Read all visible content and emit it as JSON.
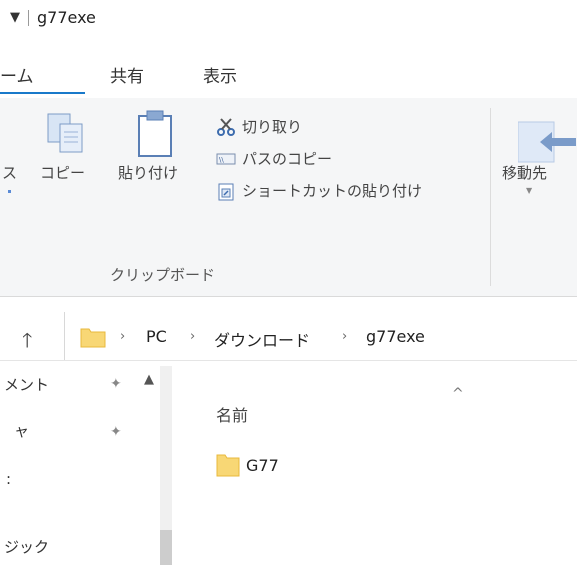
{
  "window": {
    "title": "g77exe"
  },
  "tabs": [
    {
      "label": "ーム"
    },
    {
      "label": "共有"
    },
    {
      "label": "表示"
    }
  ],
  "ribbon": {
    "clipboard": {
      "partial_label": "ス",
      "copy_label": "コピー",
      "paste_label": "貼り付け",
      "cut_label": "切り取り",
      "copy_path_label": "パスのコピー",
      "paste_shortcut_label": "ショートカットの貼り付け",
      "group_label": "クリップボード"
    },
    "organize": {
      "move_to_label": "移動先"
    }
  },
  "address_bar": {
    "breadcrumbs": [
      "PC",
      "ダウンロード",
      "g77exe"
    ]
  },
  "nav_pane": {
    "items": [
      {
        "label": "メント"
      },
      {
        "label": "ャ"
      },
      {
        "label": ":"
      },
      {
        "label": "ジック"
      }
    ]
  },
  "file_list": {
    "column_header": "名前",
    "items": [
      {
        "name": "G77",
        "type": "folder"
      }
    ]
  },
  "colors": {
    "folder": "#f8d775",
    "folder_dark": "#e8b93c",
    "arrow": "#3b6fb6"
  },
  "icons": [
    "quick-access-arrow-icon",
    "copy-icon",
    "paste-icon",
    "cut-icon",
    "copy-path-icon",
    "paste-shortcut-icon",
    "move-to-icon",
    "up-arrow-icon",
    "folder-icon",
    "pin-icon",
    "sort-caret-icon"
  ]
}
